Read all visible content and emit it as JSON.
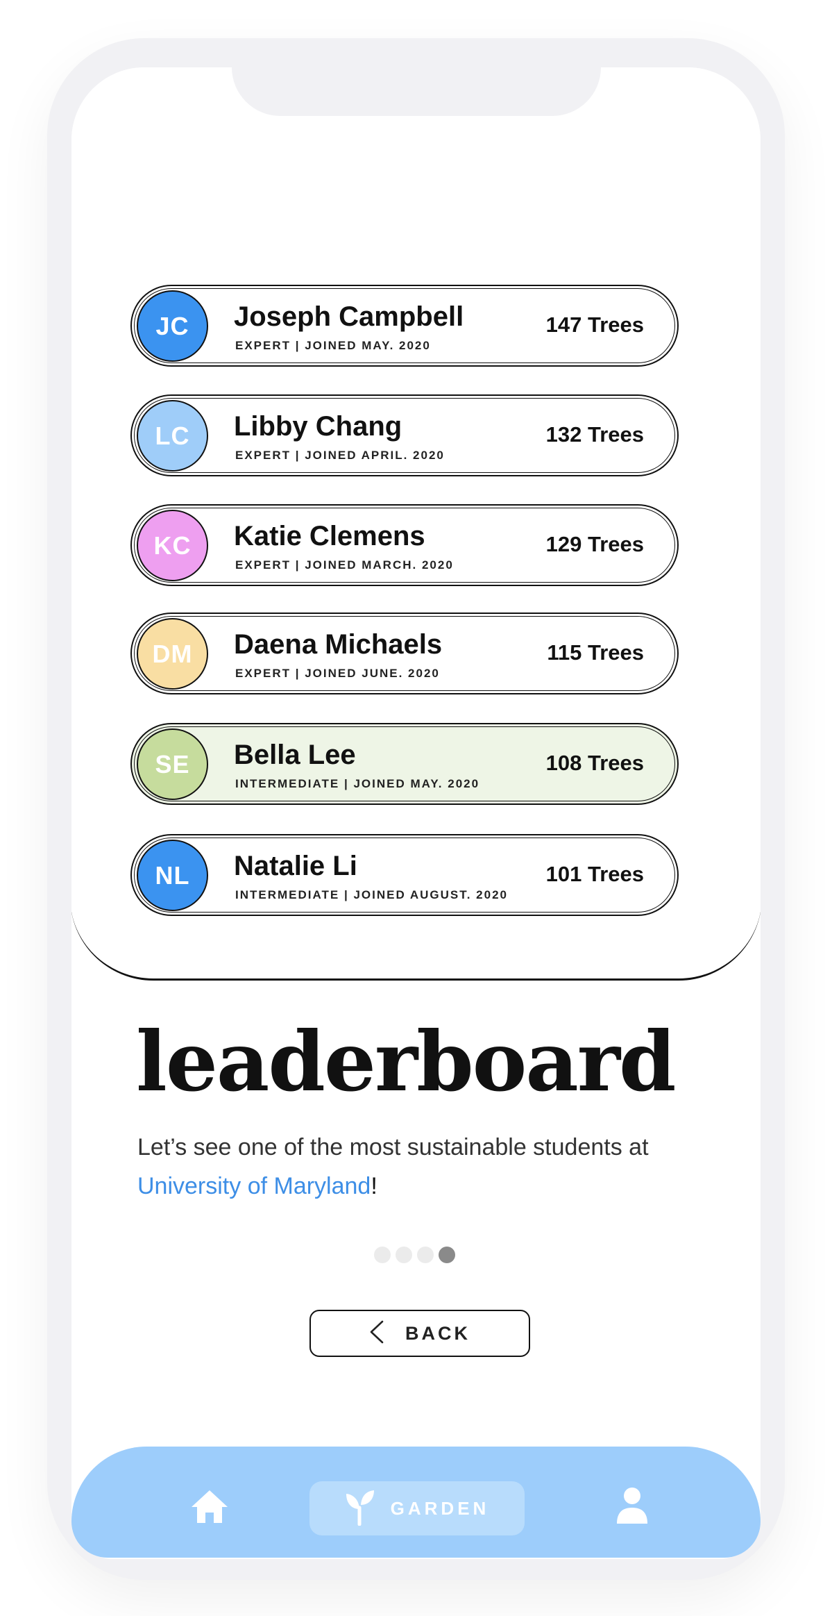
{
  "leaderboard": [
    {
      "initials": "JC",
      "name": "Joseph Campbell",
      "meta": "EXPERT | JOINED MAY. 2020",
      "trees": "147 Trees",
      "avatar_color": "#3b93f0",
      "highlight": false
    },
    {
      "initials": "LC",
      "name": "Libby Chang",
      "meta": "EXPERT | JOINED APRIL. 2020",
      "trees": "132 Trees",
      "avatar_color": "#9fcdf9",
      "highlight": false
    },
    {
      "initials": "KC",
      "name": "Katie Clemens",
      "meta": "EXPERT | JOINED MARCH. 2020",
      "trees": "129 Trees",
      "avatar_color": "#ee9ff0",
      "highlight": false
    },
    {
      "initials": "DM",
      "name": "Daena Michaels",
      "meta": "EXPERT | JOINED JUNE. 2020",
      "trees": "115 Trees",
      "avatar_color": "#f9dea3",
      "highlight": false
    },
    {
      "initials": "SE",
      "name": "Bella Lee",
      "meta": "INTERMEDIATE | JOINED MAY. 2020",
      "trees": "108 Trees",
      "avatar_color": "#c6dc9d",
      "highlight": true
    },
    {
      "initials": "NL",
      "name": "Natalie Li",
      "meta": "INTERMEDIATE | JOINED AUGUST. 2020",
      "trees": "101 Trees",
      "avatar_color": "#3b93f0",
      "highlight": false
    }
  ],
  "page": {
    "title": "leaderboard",
    "subtitle_text": "Let’s see one of the most sustainable students at ",
    "subtitle_link": "University of Maryland",
    "subtitle_end": "!"
  },
  "pagination": {
    "total": 4,
    "active_index": 3
  },
  "back_button": {
    "label": "BACK",
    "icon": "chevron-left-icon"
  },
  "nav": {
    "home_icon": "home-icon",
    "garden_label": "GARDEN",
    "garden_icon": "sprout-icon",
    "profile_icon": "user-icon",
    "bar_color": "#9dcdfb"
  },
  "colors": {
    "accent_link": "#3d8ee6",
    "highlight_row": "#eef5e6"
  }
}
